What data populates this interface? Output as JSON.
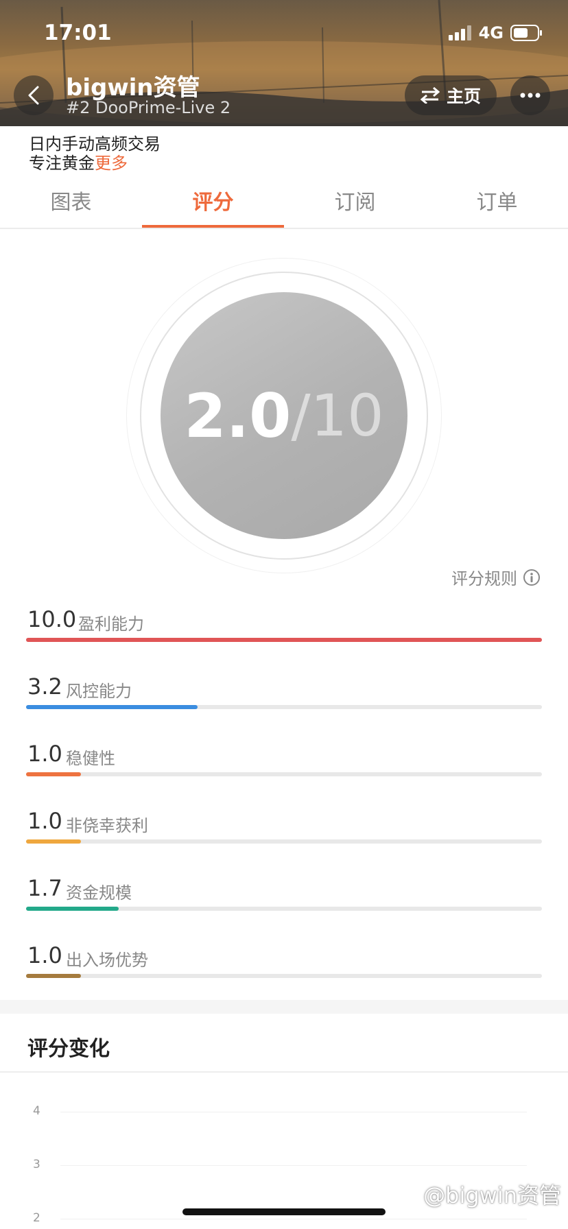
{
  "status_bar": {
    "time": "17:01",
    "network": "4G"
  },
  "header": {
    "title": "bigwin资管",
    "subtitle": "#2 DooPrime-Live 2",
    "home_label": "主页"
  },
  "bio": {
    "line1": "日内手动高频交易",
    "line2": "专注黄金",
    "more": "更多"
  },
  "tabs": [
    {
      "label": "图表"
    },
    {
      "label": "评分"
    },
    {
      "label": "订阅"
    },
    {
      "label": "订单"
    }
  ],
  "active_tab": "评分",
  "score": {
    "value": "2.0",
    "max": "/10"
  },
  "rules_label": "评分规则",
  "metrics": [
    {
      "value": "10.0",
      "label": "盈利能力",
      "fraction": 1.0,
      "color": "#e05556"
    },
    {
      "value": "3.2",
      "label": "风控能力",
      "fraction": 0.333,
      "color": "#3b8de0"
    },
    {
      "value": "1.0",
      "label": "稳健性",
      "fraction": 0.107,
      "color": "#ee7340"
    },
    {
      "value": "1.0",
      "label": "非侥幸获利",
      "fraction": 0.107,
      "color": "#efa73e"
    },
    {
      "value": "1.7",
      "label": "资金规模",
      "fraction": 0.18,
      "color": "#23a98a"
    },
    {
      "value": "1.0",
      "label": "出入场优势",
      "fraction": 0.107,
      "color": "#a57b3e"
    }
  ],
  "score_change": {
    "title": "评分变化",
    "y_ticks": [
      "4",
      "3",
      "2"
    ]
  },
  "watermark": "@bigwin资管",
  "colors": {
    "accent": "#ee6a3c"
  }
}
